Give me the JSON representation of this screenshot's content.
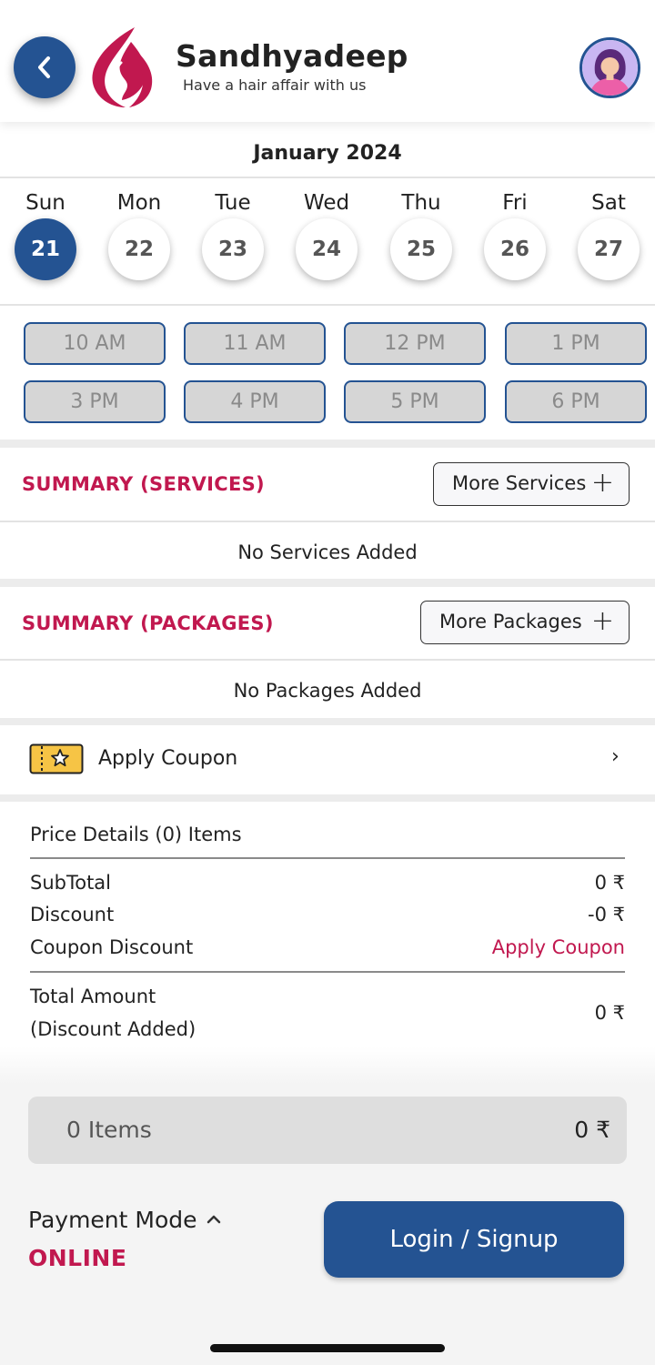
{
  "header": {
    "back_icon": "chevron-left-icon",
    "brand_name": "Sandhyadeep",
    "tagline": "Have a hair affair with us",
    "brand_color": "#c1184f",
    "accent_color": "#245392"
  },
  "calendar": {
    "month_label": "January 2024",
    "days": [
      {
        "name": "Sun",
        "date": "21",
        "selected": true
      },
      {
        "name": "Mon",
        "date": "22",
        "selected": false
      },
      {
        "name": "Tue",
        "date": "23",
        "selected": false
      },
      {
        "name": "Wed",
        "date": "24",
        "selected": false
      },
      {
        "name": "Thu",
        "date": "25",
        "selected": false
      },
      {
        "name": "Fri",
        "date": "26",
        "selected": false
      },
      {
        "name": "Sat",
        "date": "27",
        "selected": false
      }
    ],
    "time_slots": [
      "10 AM",
      "11 AM",
      "12 PM",
      "1 PM",
      "3 PM",
      "4 PM",
      "5 PM",
      "6 PM"
    ]
  },
  "services": {
    "title": "SUMMARY (SERVICES)",
    "more_label": "More Services",
    "plus": "+",
    "empty_text": "No Services Added"
  },
  "packages": {
    "title": "SUMMARY (PACKAGES)",
    "more_label": "More Packages",
    "plus": "+",
    "empty_text": "No Packages Added"
  },
  "coupon": {
    "label": "Apply Coupon",
    "chevron": "›",
    "icon": "coupon-ticket-icon"
  },
  "price_details": {
    "title": "Price Details (0) Items",
    "subtotal_label": "SubTotal",
    "subtotal_value": "0 ₹",
    "discount_label": "Discount",
    "discount_value": "-0 ₹",
    "coupon_discount_label": "Coupon Discount",
    "coupon_discount_value": "Apply Coupon",
    "total_label_line1": "Total Amount",
    "total_label_line2": "(Discount Added)",
    "total_value": "0 ₹"
  },
  "footer": {
    "cart_items": "0 Items",
    "cart_total": "0 ₹",
    "payment_label": "Payment Mode",
    "payment_mode": "ONLINE",
    "login_label": "Login / Signup"
  }
}
